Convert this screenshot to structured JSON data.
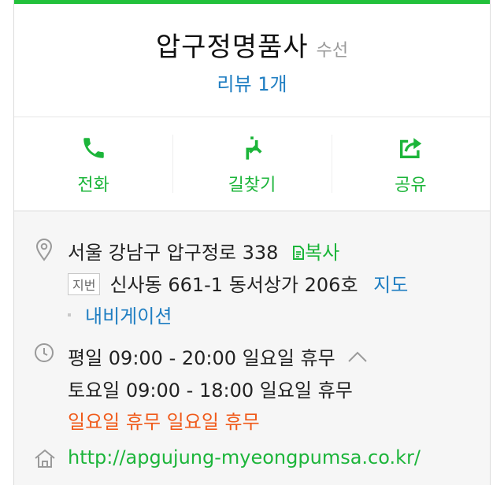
{
  "header": {
    "title": "압구정명품사",
    "category": "수선",
    "review": "리뷰 1개"
  },
  "actions": [
    {
      "label": "전화",
      "icon": "phone-icon"
    },
    {
      "label": "길찾기",
      "icon": "directions-icon"
    },
    {
      "label": "공유",
      "icon": "share-icon"
    }
  ],
  "address": {
    "road": "서울 강남구 압구정로 338",
    "copy_label": "복사",
    "lot_badge": "지번",
    "lot": "신사동 661-1 동서상가 206호",
    "map_label": "지도",
    "navigation_label": "내비게이션"
  },
  "hours": {
    "weekday": "평일 09:00 - 20:00 일요일 휴무",
    "saturday": "토요일 09:00 - 18:00 일요일 휴무",
    "holiday": "일요일 휴무 일요일 휴무"
  },
  "website": {
    "url": "http://apgujung-myeongpumsa.co.kr/"
  },
  "colors": {
    "accent_green": "#22c13b",
    "link_blue": "#1f7ec2",
    "warning_orange": "#f05a1a"
  }
}
